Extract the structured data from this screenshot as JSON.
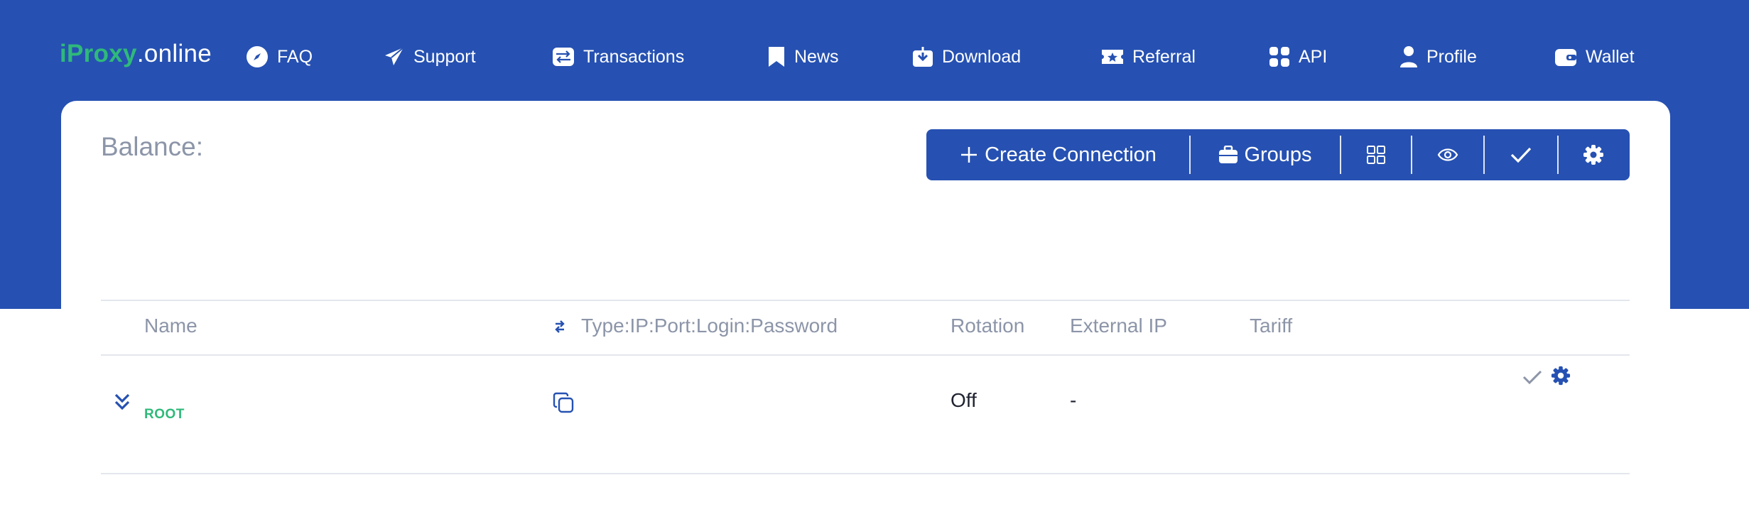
{
  "logo": {
    "brand": "iProxy",
    "suffix": ".online"
  },
  "nav": {
    "faq": "FAQ",
    "support": "Support",
    "transactions": "Transactions",
    "news": "News",
    "download": "Download",
    "referral": "Referral",
    "api": "API",
    "profile": "Profile",
    "wallet": "Wallet"
  },
  "balance_label": "Balance:",
  "toolbar": {
    "create_connection": "Create Connection",
    "groups": "Groups"
  },
  "table": {
    "headers": {
      "name": "Name",
      "connection": "Type:IP:Port:Login:Password",
      "rotation": "Rotation",
      "external_ip": "External IP",
      "tariff": "Tariff"
    },
    "rows": [
      {
        "group": "ROOT",
        "rotation": "Off",
        "external_ip": "-",
        "tariff": ""
      }
    ]
  },
  "colors": {
    "primary": "#2651b2",
    "accent_green": "#2fb97a",
    "muted_text": "#8c95a8"
  }
}
